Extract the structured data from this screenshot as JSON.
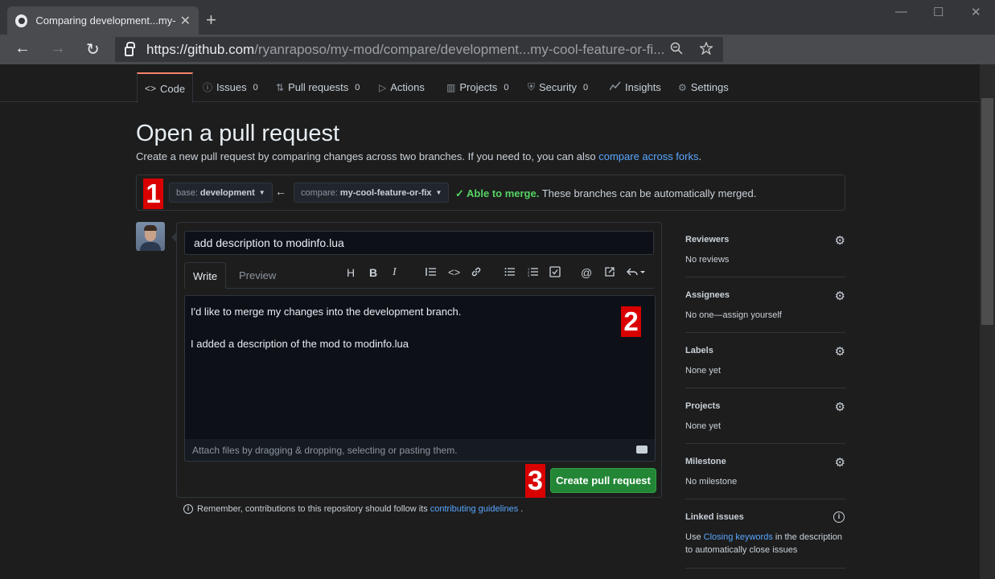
{
  "browser": {
    "tab_title": "Comparing development...my-cool-feature-or-fix",
    "tab_close": "✕",
    "new_tab": "+",
    "url_host": "https://github.com",
    "url_path": "/ryanraposo/my-mod/compare/development...my-cool-feature-or-fi...",
    "window_controls": [
      "—",
      "☐",
      "✕"
    ],
    "nav": {
      "back": "←",
      "forward": "→",
      "reload": "↻"
    },
    "icons": {
      "zoom": "zoom-icon",
      "star": "star-icon"
    }
  },
  "repo_nav": {
    "tabs": [
      {
        "label": "Code",
        "icon": "<>",
        "count": ""
      },
      {
        "label": "Issues",
        "icon": "ⓘ",
        "count": "0"
      },
      {
        "label": "Pull requests",
        "icon": "⇅",
        "count": "0"
      },
      {
        "label": "Actions",
        "icon": "▷",
        "count": ""
      },
      {
        "label": "Projects",
        "icon": "▥",
        "count": "0"
      },
      {
        "label": "Security",
        "icon": "⛨",
        "count": "0"
      },
      {
        "label": "Insights",
        "icon": "⁄",
        "count": ""
      },
      {
        "label": "Settings",
        "icon": "⚙",
        "count": ""
      }
    ]
  },
  "page": {
    "title": "Open a pull request",
    "subtitle": "Create a new pull request by comparing changes across two branches. If you need to, you can also ",
    "subtitle_link": "compare across forks",
    "subtitle_end": "."
  },
  "range": {
    "base_prefix": "base:",
    "base_branch": "development",
    "compare_prefix": "compare:",
    "compare_branch": "my-cool-feature-or-fix",
    "merge_ok": "Able to merge.",
    "merge_text": " These branches can be automatically merged."
  },
  "compose": {
    "title_value": "add description to modinfo.lua",
    "tab_write": "Write",
    "tab_preview": "Preview",
    "toolbar": [
      "H",
      "B",
      "I",
      "quote",
      "code",
      "link",
      "ul",
      "ol",
      "task",
      "@",
      "ref",
      "reply"
    ],
    "body_lines": [
      "I'd like to merge my changes into the development branch.",
      "",
      "I added a description of the mod to   modinfo.lua"
    ],
    "attach_hint": "Attach files by dragging & dropping, selecting or pasting them.",
    "submit_label": "Create pull request"
  },
  "remember": {
    "text": "Remember, contributions to this repository should follow its",
    "link": "contributing guidelines",
    "end": "."
  },
  "sidebar": [
    {
      "title": "Reviewers",
      "value": "No reviews"
    },
    {
      "title": "Assignees",
      "value": "No one—assign yourself"
    },
    {
      "title": "Labels",
      "value": "None yet"
    },
    {
      "title": "Projects",
      "value": "None yet"
    },
    {
      "title": "Milestone",
      "value": "No milestone"
    },
    {
      "title": "Linked issues",
      "value_prefix": "Use ",
      "value_link": "Closing keywords",
      "value_suffix": " in the description to automatically close issues"
    }
  ],
  "annotations": [
    "1",
    "2",
    "3"
  ],
  "colors": {
    "accent": "#58a6ff",
    "success": "#238636",
    "annotation": "#d90000",
    "tab_underline": "#f9826c"
  }
}
